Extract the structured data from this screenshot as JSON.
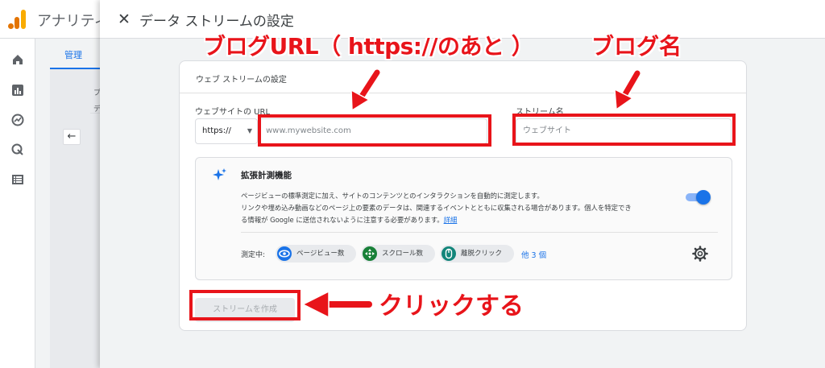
{
  "background": {
    "app_title": "アナリティ",
    "admin_tab": "管理",
    "frag1": "プ",
    "frag2": "デ",
    "back_icon": "arrow-left-icon",
    "rail_icons": [
      "home-icon",
      "reports-icon",
      "explore-icon",
      "advertising-icon",
      "configure-icon"
    ]
  },
  "dialog": {
    "title": "データ ストリームの設定",
    "close_icon": "close-icon",
    "card_title": "ウェブ ストリームの設定",
    "url_label": "ウェブサイトの URL",
    "protocol_value": "https://",
    "url_placeholder": "www.mywebsite.com",
    "stream_name_label": "ストリーム名",
    "stream_name_placeholder": "ウェブサイト",
    "enhanced": {
      "title": "拡張計測機能",
      "desc_line1": "ページビューの標準測定に加え、サイトのコンテンツとのインタラクションを自動的に測定します。",
      "desc_line2": "リンクや埋め込み動画などのページ上の要素のデータは、関連するイベントとともに収集される場合があります。個人を特定でき",
      "desc_line3": "る情報が Google に送信されないように注意する必要があります。",
      "details_link": "詳細",
      "toggle_on": true,
      "measuring_label": "測定中:",
      "chips": [
        {
          "label": "ページビュー数",
          "icon": "eye-icon",
          "color": "#1a73e8"
        },
        {
          "label": "スクロール数",
          "icon": "move-icon",
          "color": "#188038"
        },
        {
          "label": "離脱クリック",
          "icon": "mouse-icon",
          "color": "#12857a"
        }
      ],
      "more": "他 3 個"
    },
    "create_button": "ストリームを作成"
  },
  "annotations": {
    "blog_url": "ブログURL（ https://のあと ）",
    "blog_name": "ブログ名",
    "click": "クリックする",
    "color": "#e8141a"
  }
}
